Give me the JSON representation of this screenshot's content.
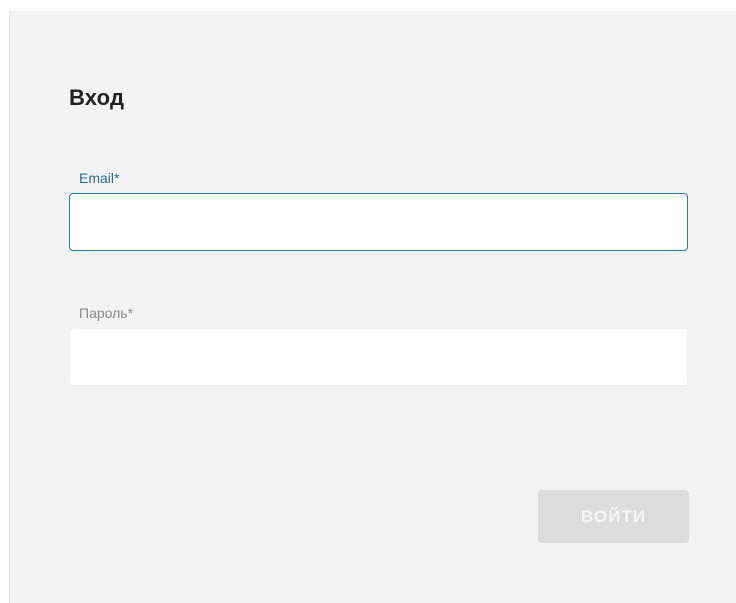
{
  "login_form": {
    "title": "Вход",
    "email": {
      "label": "Email*",
      "value": "",
      "placeholder": ""
    },
    "password": {
      "label": "Пароль*",
      "value": "",
      "placeholder": ""
    },
    "submit_label": "ВОЙТИ"
  },
  "colors": {
    "panel_background": "#f3f3f3",
    "active_field_border": "#2d7c99",
    "active_label": "#2f6d86",
    "inactive_label": "#8a8a8a",
    "disabled_button": "#dcdcdc"
  }
}
